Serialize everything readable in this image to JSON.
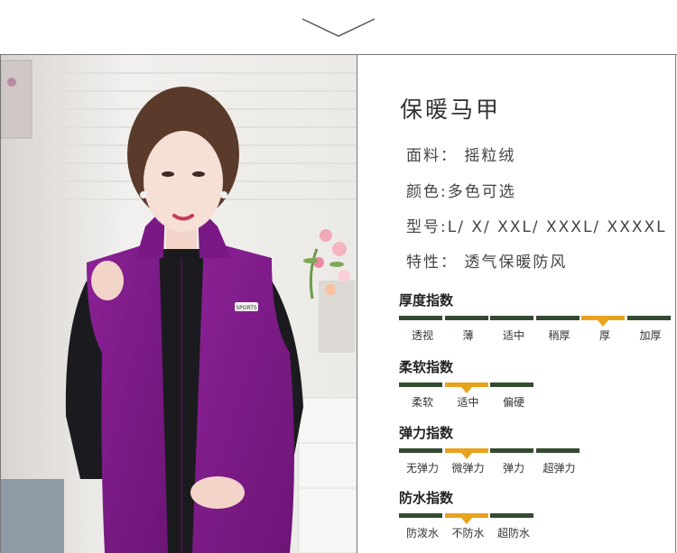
{
  "product": {
    "title": "保暖马甲",
    "specs": [
      {
        "text": "面料： 摇粒绒"
      },
      {
        "text": "颜色:多色可选"
      },
      {
        "text": "型号:L/ X/ XXL/  XXXL/ XXXXL"
      },
      {
        "text": "特性： 透气保暖防风"
      }
    ]
  },
  "photo": {
    "vest_badge": "SPORTS"
  },
  "indices": [
    {
      "title": "厚度指数",
      "options": [
        "透视",
        "薄",
        "适中",
        "稍厚",
        "厚",
        "加厚"
      ],
      "selected": 4
    },
    {
      "title": "柔软指数",
      "options": [
        "柔软",
        "适中",
        "偏硬"
      ],
      "selected": 1
    },
    {
      "title": "弹力指数",
      "options": [
        "无弹力",
        "微弹力",
        "弹力",
        "超弹力"
      ],
      "selected": 1
    },
    {
      "title": "防水指数",
      "options": [
        "防泼水",
        "不防水",
        "超防水"
      ],
      "selected": 1
    }
  ],
  "colors": {
    "bar": "#344b31",
    "highlight": "#e8a21c",
    "vest": "#7b1a86"
  },
  "icons": {
    "header": "chevron-down-icon"
  }
}
